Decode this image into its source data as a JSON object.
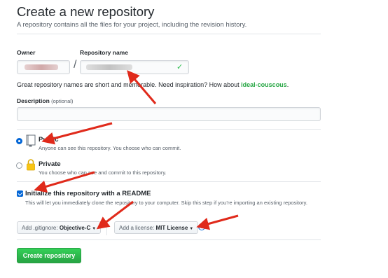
{
  "header": {
    "title": "Create a new repository",
    "subtitle": "A repository contains all the files for your project, including the revision history."
  },
  "form": {
    "owner_label": "Owner",
    "slash": "/",
    "repo_name_label": "Repository name",
    "helper_text": "Great repository names are short and memorable. Need inspiration? How about ",
    "suggestion": "ideal-couscous",
    "helper_end": ".",
    "description_label": "Description",
    "description_optional": "(optional)",
    "description_value": ""
  },
  "visibility": {
    "public_title": "Public",
    "public_desc": "Anyone can see this repository. You choose who can commit.",
    "private_title": "Private",
    "private_desc": "You choose who can see and commit to this repository."
  },
  "init": {
    "title": "Initialize this repository with a README",
    "desc": "This will let you immediately clone the repository to your computer. Skip this step if you’re importing an existing repository."
  },
  "gitignore": {
    "prefix": "Add .gitignore: ",
    "value": "Objective-C"
  },
  "license": {
    "prefix": "Add a license: ",
    "value": "MIT License"
  },
  "submit_label": "Create repository",
  "colors": {
    "accent_blue": "#0366d6",
    "success_green": "#28a745",
    "annotation_red": "#e02a1b"
  },
  "icons": {
    "public": "book-icon",
    "private": "lock-icon",
    "valid": "check-icon",
    "info": "info-icon",
    "caret": "caret-down-icon"
  }
}
